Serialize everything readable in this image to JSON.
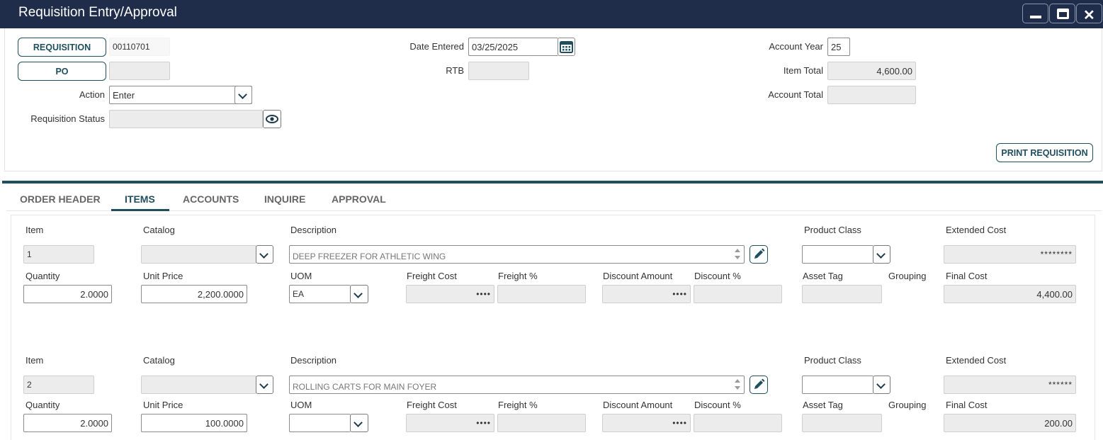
{
  "window": {
    "title": "Requisition Entry/Approval",
    "controls": [
      "minimize-icon",
      "maximize-icon",
      "close-icon"
    ]
  },
  "header": {
    "requisition_button": "REQUISITION",
    "requisition_number": "00110701",
    "po_button": "PO",
    "po_value": "",
    "action_label": "Action",
    "action_value": "Enter",
    "status_label": "Requisition Status",
    "status_value": "",
    "date_entered_label": "Date Entered",
    "date_entered_value": "03/25/2025",
    "rtb_label": "RTB",
    "rtb_value": "",
    "account_year_label": "Account Year",
    "account_year_value": "25",
    "item_total_label": "Item Total",
    "item_total_value": "4,600.00",
    "account_total_label": "Account Total",
    "account_total_value": "",
    "print_button": "PRINT REQUISITION"
  },
  "tabs": [
    {
      "label": "ORDER HEADER",
      "active": false
    },
    {
      "label": "ITEMS",
      "active": true
    },
    {
      "label": "ACCOUNTS",
      "active": false
    },
    {
      "label": "INQUIRE",
      "active": false
    },
    {
      "label": "APPROVAL",
      "active": false
    }
  ],
  "labels": {
    "item": "Item",
    "catalog": "Catalog",
    "description": "Description",
    "product_class": "Product Class",
    "extended_cost": "Extended Cost",
    "quantity": "Quantity",
    "unit_price": "Unit Price",
    "uom": "UOM",
    "freight_cost": "Freight Cost",
    "freight_pct": "Freight %",
    "discount_amount": "Discount Amount",
    "discount_pct": "Discount %",
    "asset_tag": "Asset Tag",
    "grouping": "Grouping",
    "final_cost": "Final Cost"
  },
  "items": [
    {
      "item": "1",
      "catalog": "",
      "description": "DEEP FREEZER FOR ATHLETIC WING",
      "product_class": "",
      "extended_cost": "********",
      "quantity": "2.0000",
      "unit_price": "2,200.0000",
      "uom": "EA",
      "freight_cost": "••••",
      "freight_pct": "",
      "discount_amount": "••••",
      "discount_pct": "",
      "asset_tag": "",
      "final_cost": "4,400.00"
    },
    {
      "item": "2",
      "catalog": "",
      "description": "ROLLING CARTS FOR MAIN FOYER",
      "product_class": "",
      "extended_cost": "******",
      "quantity": "2.0000",
      "unit_price": "100.0000",
      "uom": "",
      "freight_cost": "••••",
      "freight_pct": "",
      "discount_amount": "••••",
      "discount_pct": "",
      "asset_tag": "",
      "final_cost": "200.00"
    }
  ],
  "colors": {
    "titlebar": "#1f2d4a",
    "accent": "#1f4e5e"
  }
}
